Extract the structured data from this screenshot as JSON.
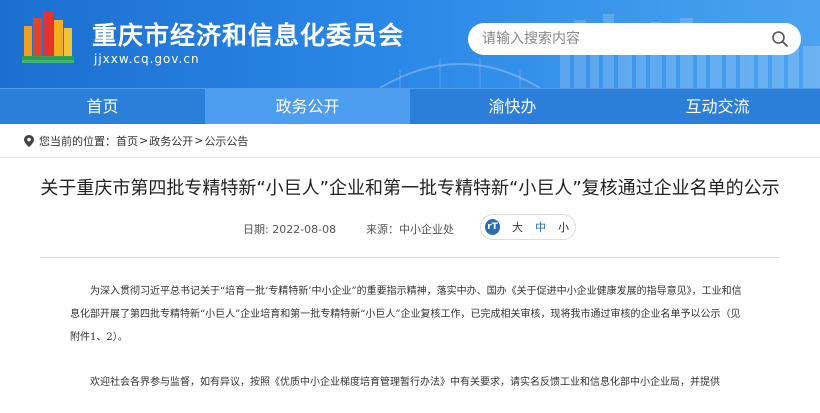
{
  "header": {
    "title": "重庆市经济和信息化委员会",
    "domain": "jjxxw.cq.gov.cn",
    "search": {
      "placeholder": "请输入搜索内容"
    }
  },
  "nav": {
    "items": [
      {
        "label": "首页"
      },
      {
        "label": "政务公开"
      },
      {
        "label": "渝快办"
      },
      {
        "label": "互动交流"
      }
    ]
  },
  "breadcrumb": {
    "prefix": "您当前的位置：",
    "items": [
      "首页",
      "政务公开",
      "公示公告"
    ],
    "separator": ">"
  },
  "article": {
    "title": "关于重庆市第四批专精特新“小巨人”企业和第一批专精特新“小巨人”复核通过企业名单的公示",
    "date": "日期: 2022-08-08",
    "source": "来源：中小企业处",
    "font_size": {
      "large": "大",
      "medium": "中",
      "small": "小"
    },
    "paragraphs": [
      "为深入贯彻习近平总书记关于“培育一批‘专精特新’中小企业”的重要指示精神，落实中办、国办《关于促进中小企业健康发展的指导意见》，工业和信息化部开展了第四批专精特新“小巨人”企业培育和第一批专精特新“小巨人”企业复核工作，已完成相关审核，现将我市通过审核的企业名单予以公示（见附件1、2）。",
      "欢迎社会各界参与监督，如有异议，按照《优质中小企业梯度培育管理暂行办法》中有关要求，请实名反馈工业和信息化部中小企业局，并提供"
    ]
  },
  "colors": {
    "header_blue": "#1b6fd0",
    "nav_blue": "#2b7fd8",
    "nav_active": "#4d9ef0",
    "accent": "#2b6cb8"
  }
}
